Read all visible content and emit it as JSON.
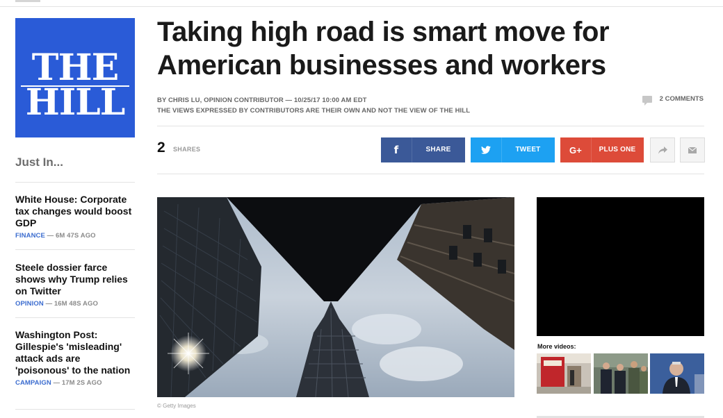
{
  "site": {
    "logo_line1": "THE",
    "logo_line2": "HILL"
  },
  "sidebar": {
    "heading": "Just In...",
    "stories": [
      {
        "title": "White House: Corporate tax changes would boost GDP",
        "category": "FINANCE",
        "age": " — 6M 47S AGO"
      },
      {
        "title": "Steele dossier farce shows why Trump relies on Twitter",
        "category": "OPINION",
        "age": " — 16M 48S AGO"
      },
      {
        "title": "Washington Post: Gillespie's 'misleading' attack ads are 'poisonous' to the nation",
        "category": "CAMPAIGN",
        "age": " — 17M 2S AGO"
      }
    ]
  },
  "article": {
    "headline": "Taking high road is smart move for American businesses and workers",
    "byline": "BY CHRIS LU, OPINION CONTRIBUTOR — 10/25/17 10:00 AM EDT",
    "disclaimer": "THE VIEWS EXPRESSED BY CONTRIBUTORS ARE THEIR OWN AND NOT THE VIEW OF THE HILL",
    "comments": "2 COMMENTS",
    "image_credit": "© Getty Images"
  },
  "share": {
    "count": "2",
    "count_label": "SHARES",
    "facebook": {
      "icon": "f",
      "label": "SHARE",
      "color": "#3b5998"
    },
    "twitter": {
      "label": "TWEET",
      "color": "#1da1f2"
    },
    "google": {
      "icon": "G+",
      "label": "PLUS ONE",
      "color": "#dd4b39"
    },
    "forward_icon": "forward-arrow-icon",
    "email_icon": "envelope-icon"
  },
  "video": {
    "more_label": "More videos:"
  },
  "colors": {
    "brand_blue": "#2a5bd7",
    "link_blue": "#3b6ccf"
  }
}
